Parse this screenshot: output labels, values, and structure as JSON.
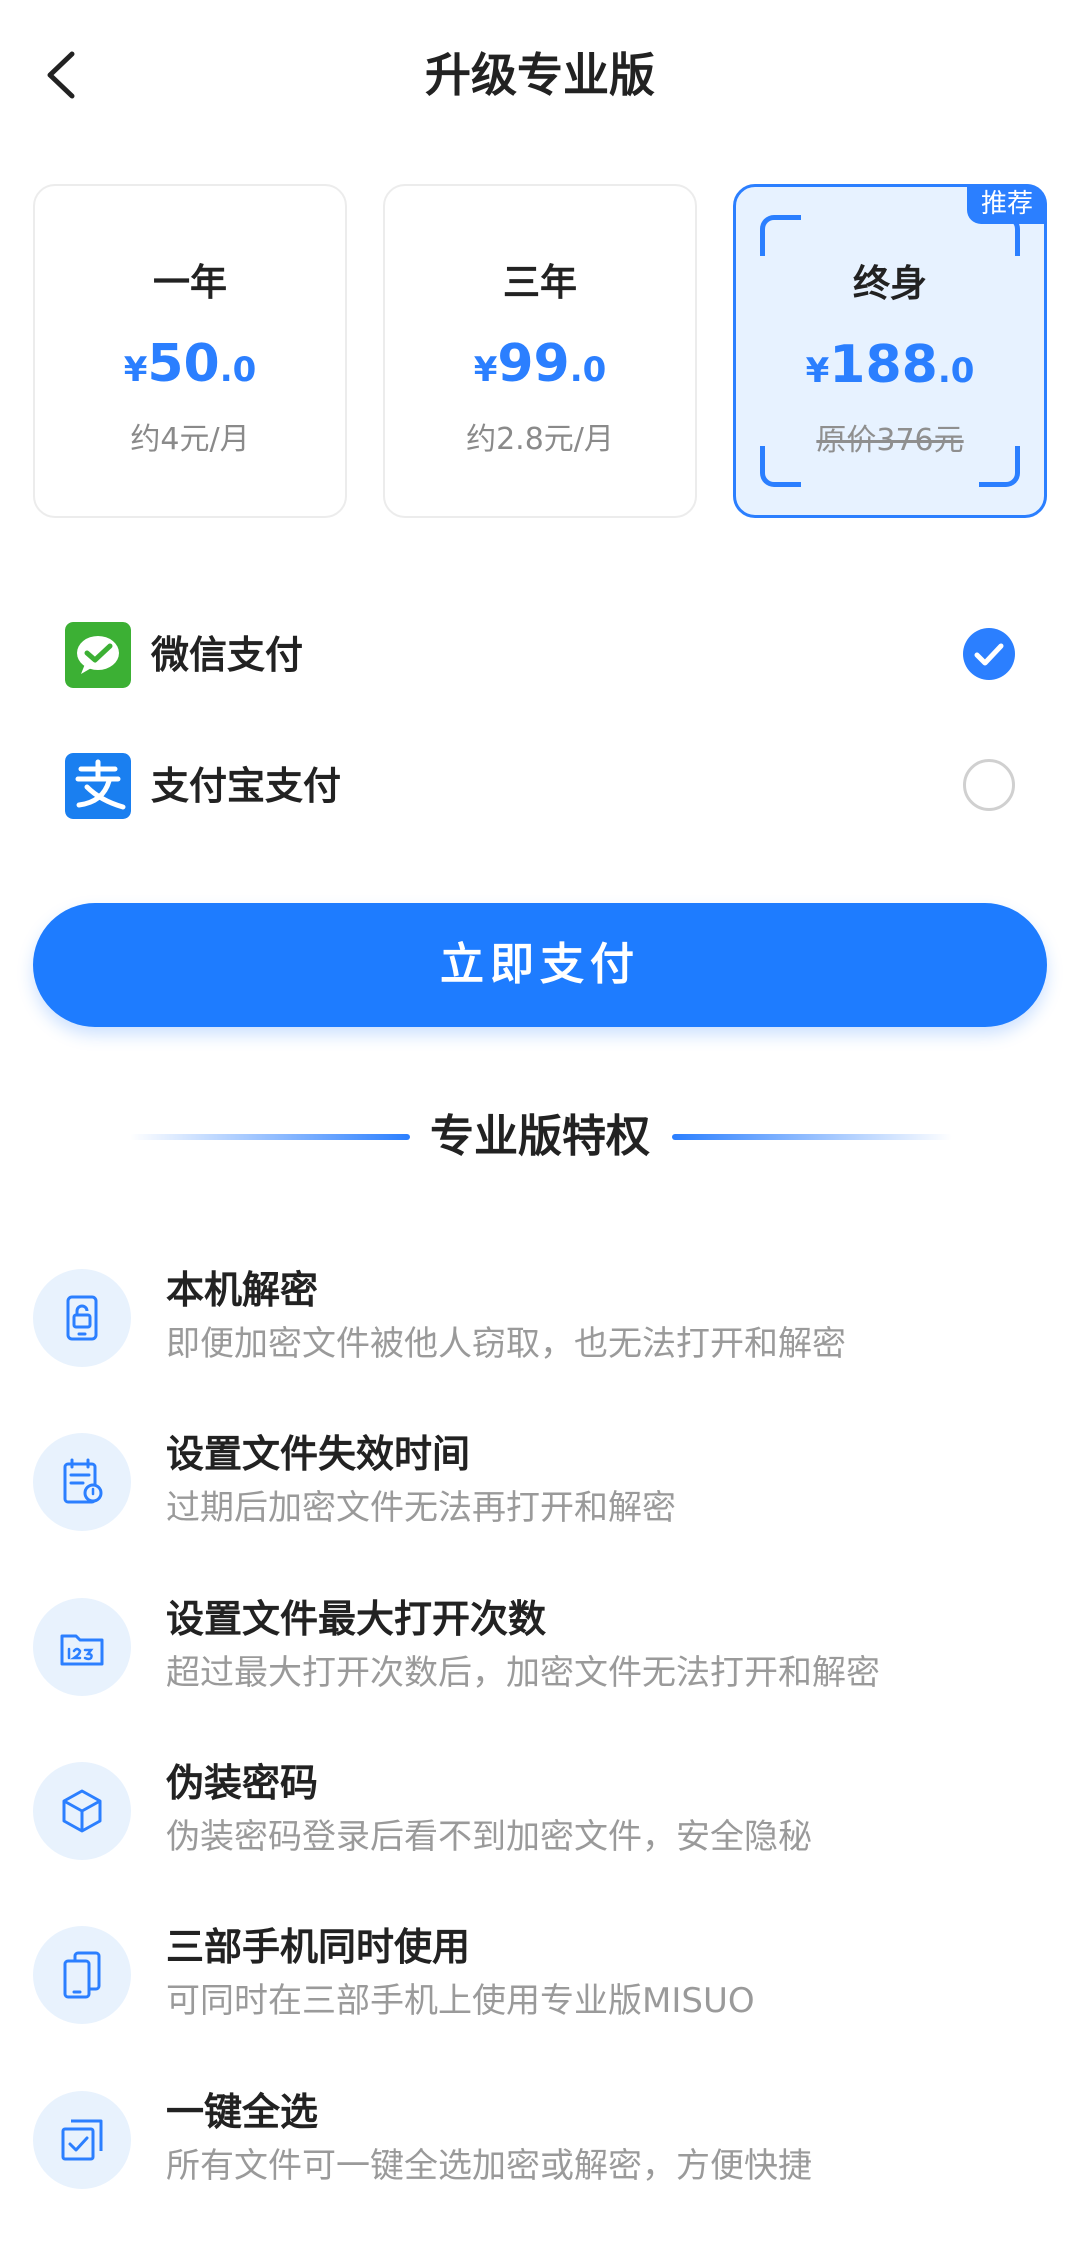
{
  "header": {
    "title": "升级专业版",
    "back_icon": "chevron-left-icon"
  },
  "plans": [
    {
      "name": "一年",
      "currency": "¥",
      "price_int": "50",
      "price_dec": ".0",
      "note": "约4元/月",
      "selected": false
    },
    {
      "name": "三年",
      "currency": "¥",
      "price_int": "99",
      "price_dec": ".0",
      "note": "约2.8元/月",
      "selected": false
    },
    {
      "name": "终身",
      "currency": "¥",
      "price_int": "188",
      "price_dec": ".0",
      "note": "原价376元",
      "selected": true,
      "badge": "推荐"
    }
  ],
  "payment": {
    "methods": [
      {
        "label": "微信支付",
        "icon": "wechat-pay-icon",
        "checked": true
      },
      {
        "label": "支付宝支付",
        "icon": "alipay-icon",
        "checked": false
      }
    ],
    "pay_button": "立即支付"
  },
  "features": {
    "section_title": "专业版特权",
    "items": [
      {
        "title": "本机解密",
        "desc": "即便加密文件被他人窃取，也无法打开和解密",
        "icon": "phone-lock-icon"
      },
      {
        "title": "设置文件失效时间",
        "desc": "过期后加密文件无法再打开和解密",
        "icon": "calendar-clock-icon"
      },
      {
        "title": "设置文件最大打开次数",
        "desc": "超过最大打开次数后，加密文件无法打开和解密",
        "icon": "folder-counter-icon"
      },
      {
        "title": "伪装密码",
        "desc": "伪装密码登录后看不到加密文件，安全隐秘",
        "icon": "cube-icon"
      },
      {
        "title": "三部手机同时使用",
        "desc": "可同时在三部手机上使用专业版MISUO",
        "icon": "multi-device-icon"
      },
      {
        "title": "一键全选",
        "desc": "所有文件可一键全选加密或解密，方便快捷",
        "icon": "select-all-icon"
      }
    ]
  },
  "colors": {
    "accent": "#1e7cff",
    "selected_bg": "#e7f2ff",
    "wechat_green": "#3cb034",
    "alipay_blue": "#1a7ff0"
  }
}
